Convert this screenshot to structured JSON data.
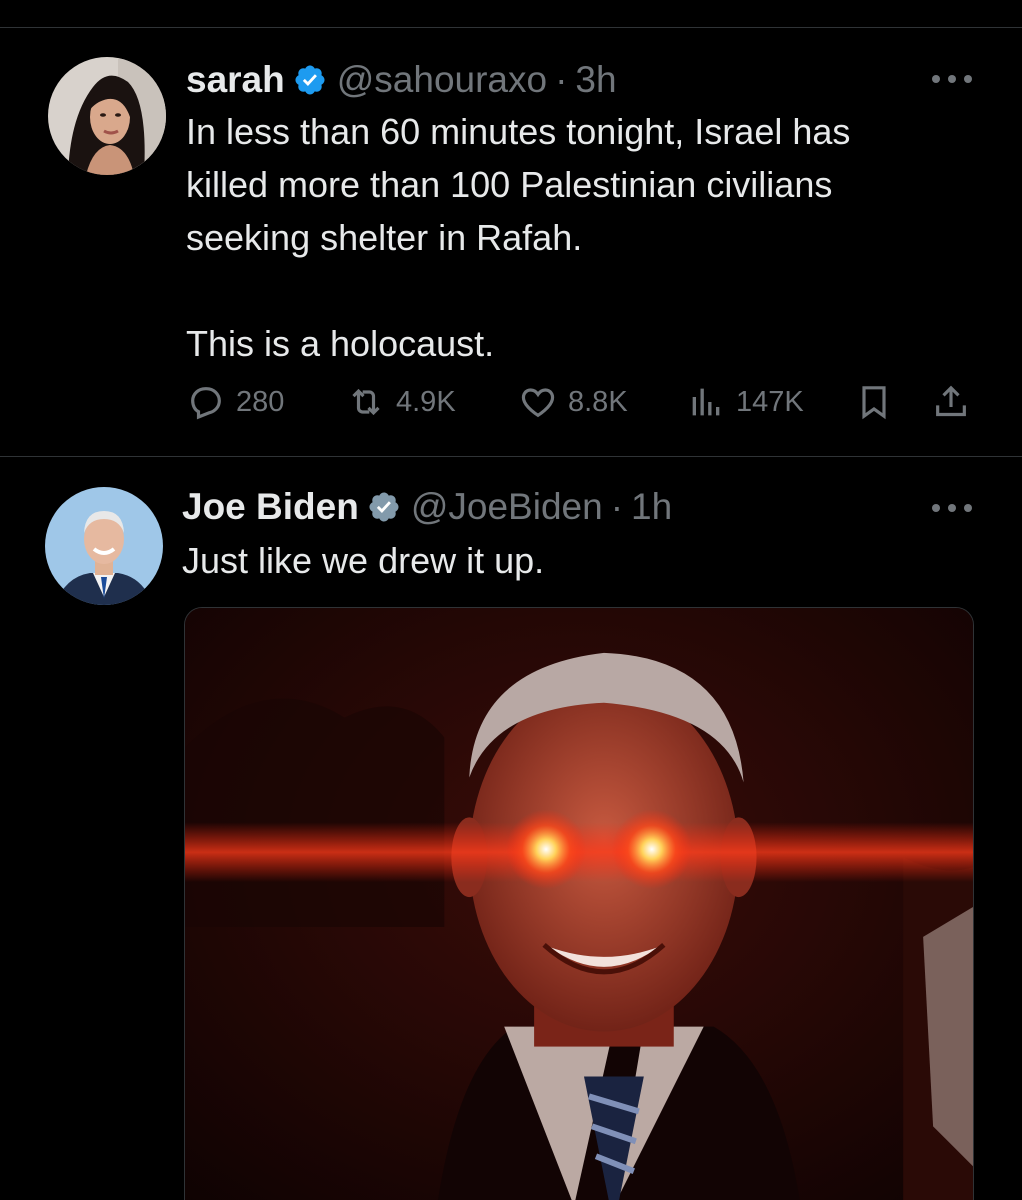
{
  "tweets": [
    {
      "display_name": "sarah",
      "handle": "@sahouraxo",
      "separator": "·",
      "time": "3h",
      "verified": true,
      "avatar": "woman-portrait-avatar",
      "text": "In less than 60 minutes tonight, Israel has\nkilled more than 100 Palestinian civilians\nseeking shelter in Rafah.\n\nThis is a holocaust.",
      "stats": {
        "replies": "280",
        "reposts": "4.9K",
        "likes": "8.8K",
        "views": "147K"
      }
    },
    {
      "display_name": "Joe Biden",
      "handle": "@JoeBiden",
      "separator": "·",
      "time": "1h",
      "verified": true,
      "avatar": "man-portrait-avatar",
      "text": "Just like we drew it up.",
      "media": "red-tinted portrait with glowing laser eyes"
    }
  ],
  "icons": {
    "verified": "verified-badge-icon",
    "more": "more-options-icon",
    "reply": "reply-icon",
    "repost": "repost-icon",
    "like": "like-icon",
    "views": "views-icon",
    "bookmark": "bookmark-icon",
    "share": "share-icon"
  },
  "colors": {
    "background": "#000000",
    "text": "#e7e9ea",
    "muted": "#71767b",
    "divider": "#2f3336",
    "verified_blue": "#1d9bf0"
  }
}
